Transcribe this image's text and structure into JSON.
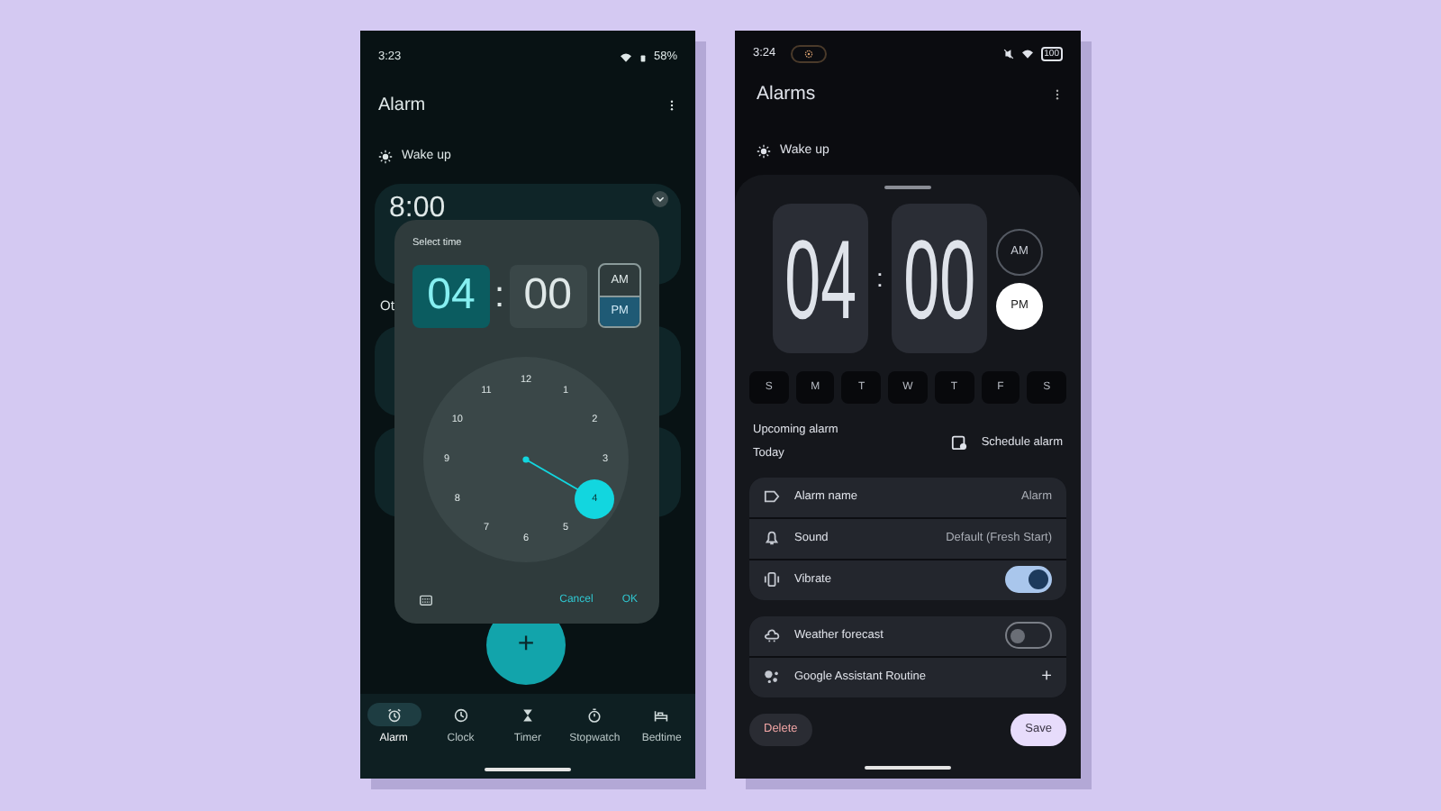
{
  "left_screen": {
    "status_bar": {
      "time": "3:23",
      "battery": "58%"
    },
    "title": "Alarm",
    "section": "Wake up",
    "background": {
      "alarm_time": "8:00",
      "label_fragment": "Ot"
    },
    "time_picker": {
      "title": "Select time",
      "hour": "04",
      "separator": ":",
      "minute": "00",
      "periods": [
        {
          "label": "AM",
          "selected": false
        },
        {
          "label": "PM",
          "selected": true
        }
      ],
      "dial": [
        {
          "label": "12",
          "selected": false
        },
        {
          "label": "1",
          "selected": false
        },
        {
          "label": "2",
          "selected": false
        },
        {
          "label": "3",
          "selected": false
        },
        {
          "label": "4",
          "selected": true
        },
        {
          "label": "5",
          "selected": false
        },
        {
          "label": "6",
          "selected": false
        },
        {
          "label": "7",
          "selected": false
        },
        {
          "label": "8",
          "selected": false
        },
        {
          "label": "9",
          "selected": false
        },
        {
          "label": "10",
          "selected": false
        },
        {
          "label": "11",
          "selected": false
        }
      ],
      "buttons": [
        "Cancel",
        "OK"
      ]
    },
    "fab": "+",
    "nav": [
      {
        "label": "Alarm",
        "selected": true
      },
      {
        "label": "Clock",
        "selected": false
      },
      {
        "label": "Timer",
        "selected": false
      },
      {
        "label": "Stopwatch",
        "selected": false
      },
      {
        "label": "Bedtime",
        "selected": false
      }
    ]
  },
  "right_screen": {
    "status_bar": {
      "time": "3:24",
      "battery": "100"
    },
    "title": "Alarms",
    "section": "Wake up",
    "time": {
      "hour": "04",
      "separator": ":",
      "minute": "00"
    },
    "periods": [
      {
        "label": "AM",
        "selected": false
      },
      {
        "label": "PM",
        "selected": true
      }
    ],
    "days": [
      {
        "label": "S",
        "selected": false
      },
      {
        "label": "M",
        "selected": false
      },
      {
        "label": "T",
        "selected": false
      },
      {
        "label": "W",
        "selected": false
      },
      {
        "label": "T",
        "selected": false
      },
      {
        "label": "F",
        "selected": false
      },
      {
        "label": "S",
        "selected": false
      }
    ],
    "upcoming": {
      "label": "Upcoming alarm",
      "day": "Today",
      "action": "Schedule alarm"
    },
    "settings_groups": [
      [
        {
          "kind": "text",
          "label": "Alarm name",
          "value": "Alarm"
        },
        {
          "kind": "text",
          "label": "Sound",
          "value": "Default (Fresh Start)"
        },
        {
          "kind": "toggle",
          "label": "Vibrate",
          "on": true
        }
      ],
      [
        {
          "kind": "toggle",
          "label": "Weather forecast",
          "on": false
        },
        {
          "kind": "add",
          "label": "Google Assistant Routine",
          "value": "+"
        }
      ]
    ],
    "buttons": {
      "delete": "Delete",
      "save": "Save"
    }
  }
}
